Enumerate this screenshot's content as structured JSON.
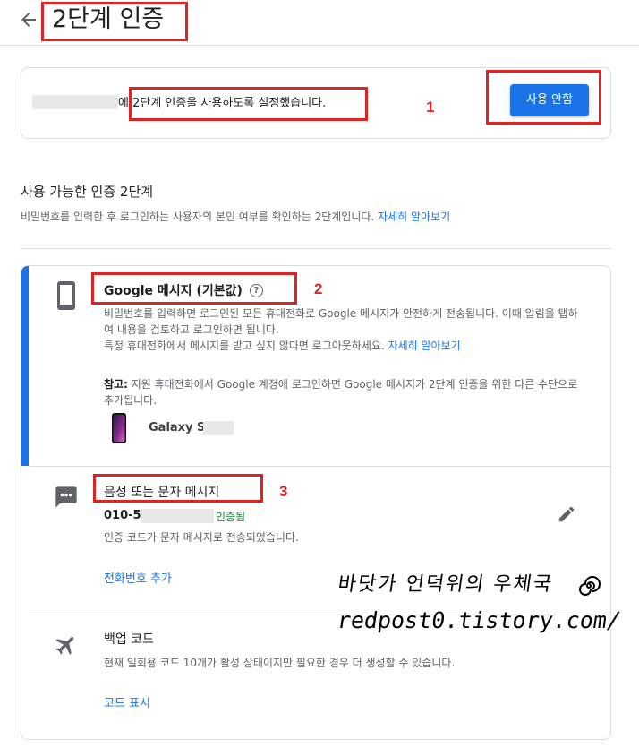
{
  "header": {
    "title": "2단계 인증"
  },
  "status": {
    "text": "에 2단계 인증을 사용하도록 설정했습니다.",
    "button_label": "사용 안함"
  },
  "annotations": {
    "one": "1",
    "two": "2",
    "three": "3"
  },
  "section": {
    "title": "사용 가능한 인증 2단계",
    "description": "비밀번호를 입력한 후 로그인하는 사용자의 본인 여부를 확인하는 2단계입니다.",
    "learn_more": "자세히 알아보기"
  },
  "methods": {
    "google_prompt": {
      "title": "Google 메시지 (기본값)",
      "help_icon": "?",
      "desc_line1": "비밀번호를 입력하면 로그인된 모든 휴대전화로 Google 메시지가 안전하게 전송됩니다. 이때 알림을 탭하여 내용을 검토하고 로그인하면 됩니다.",
      "desc_line2": "특정 휴대전화에서 메시지를 받고 싶지 않다면 로그아웃하세요.",
      "learn_more": "자세히 알아보기",
      "note_label": "참고:",
      "note_text": " 지원 휴대전화에서 Google 계정에 로그인하면 Google 메시지가 2단계 인증을 위한 다른 수단으로 추가됩니다.",
      "device_name": "Galaxy S"
    },
    "voice_sms": {
      "title": "음성 또는 문자 메시지",
      "phone_prefix": "010-5",
      "verified": "인증됨",
      "desc": "인증 코드가 문자 메시지로 전송되었습니다.",
      "add_phone": "전화번호 추가"
    },
    "backup_codes": {
      "title": "백업 코드",
      "desc": "현재 일회용 코드 10개가 활성 상태이지만 필요한 경우 더 생성할 수 있습니다.",
      "show_codes": "코드 표시"
    }
  },
  "watermark": {
    "line1": "바닷가 언덕위의 우체국",
    "line2": "redpost0.tistory.com/"
  }
}
